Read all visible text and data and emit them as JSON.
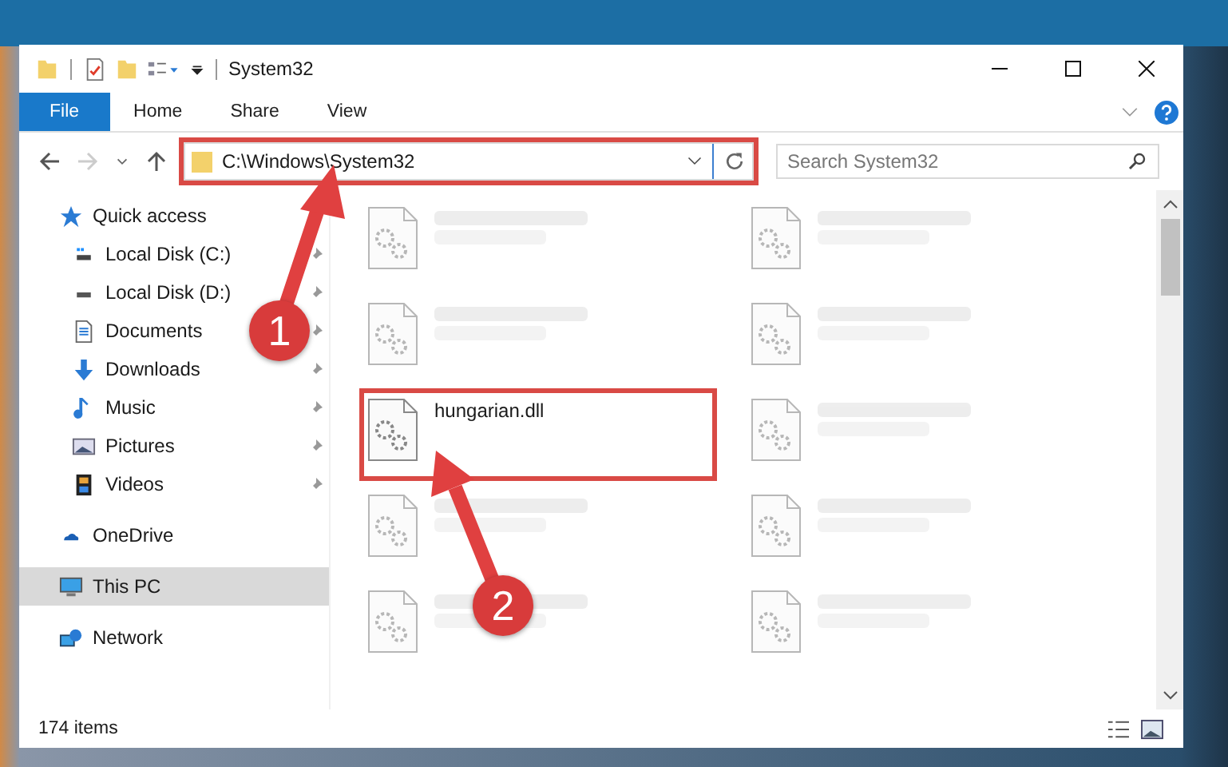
{
  "window": {
    "title": "System32"
  },
  "ribbon": {
    "tabs": [
      {
        "label": "File",
        "selected": true
      },
      {
        "label": "Home",
        "selected": false
      },
      {
        "label": "Share",
        "selected": false
      },
      {
        "label": "View",
        "selected": false
      }
    ]
  },
  "address_bar": {
    "path": "C:\\Windows\\System32",
    "highlighted": true
  },
  "search": {
    "placeholder": "Search System32"
  },
  "navigation": [
    {
      "label": "Quick access",
      "selected": false,
      "children": [
        {
          "label": "Local Disk (C:)",
          "pinned": true,
          "selected": false
        },
        {
          "label": "Local Disk (D:)",
          "pinned": true,
          "selected": false
        },
        {
          "label": "Documents",
          "pinned": true,
          "selected": false
        },
        {
          "label": "Downloads",
          "pinned": true,
          "selected": false
        },
        {
          "label": "Music",
          "pinned": true,
          "selected": false
        },
        {
          "label": "Pictures",
          "pinned": true,
          "selected": false
        },
        {
          "label": "Videos",
          "pinned": true,
          "selected": false
        }
      ]
    },
    {
      "label": "OneDrive",
      "selected": false
    },
    {
      "label": "This PC",
      "selected": true
    },
    {
      "label": "Network",
      "selected": false
    }
  ],
  "files": [
    {
      "blurred": true,
      "highlighted": false
    },
    {
      "blurred": true,
      "highlighted": false
    },
    {
      "blurred": true,
      "highlighted": false
    },
    {
      "blurred": true,
      "highlighted": false
    },
    {
      "name": "hungarian.dll",
      "blurred": false,
      "highlighted": true
    },
    {
      "blurred": true,
      "highlighted": false
    },
    {
      "blurred": true,
      "highlighted": false
    },
    {
      "blurred": true,
      "highlighted": false
    },
    {
      "blurred": true,
      "highlighted": false
    },
    {
      "blurred": true,
      "highlighted": false
    }
  ],
  "status_bar": {
    "item_count": "174 items"
  },
  "callouts": [
    {
      "number": "1"
    },
    {
      "number": "2"
    }
  ]
}
